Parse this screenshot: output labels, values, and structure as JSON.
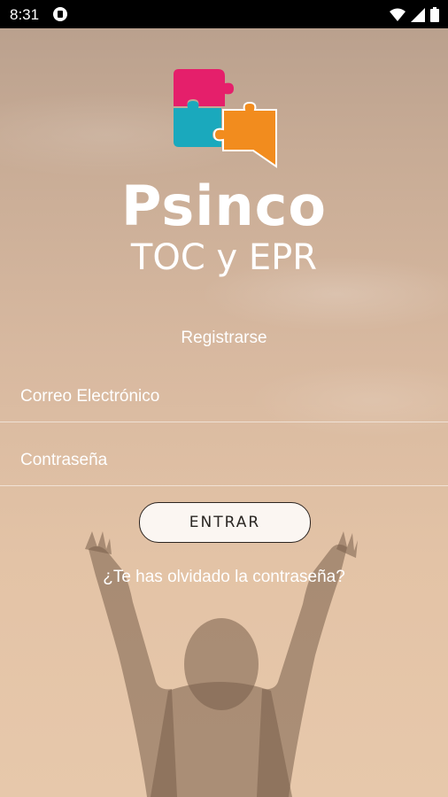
{
  "status_bar": {
    "time": "8:31",
    "icons": [
      "notification-icon",
      "wifi-icon",
      "signal-icon",
      "battery-icon"
    ]
  },
  "brand": {
    "name": "Psinco",
    "subtitle": "TOC y EPR",
    "logo_colors": {
      "pink": "#e51f6b",
      "teal": "#1aa9bd",
      "orange": "#f28c1e"
    }
  },
  "form": {
    "register_label": "Registrarse",
    "email_placeholder": "Correo Electrónico",
    "password_placeholder": "Contraseña",
    "submit_label": "ENTRAR",
    "forgot_label": "¿Te has olvidado la contraseña?"
  }
}
